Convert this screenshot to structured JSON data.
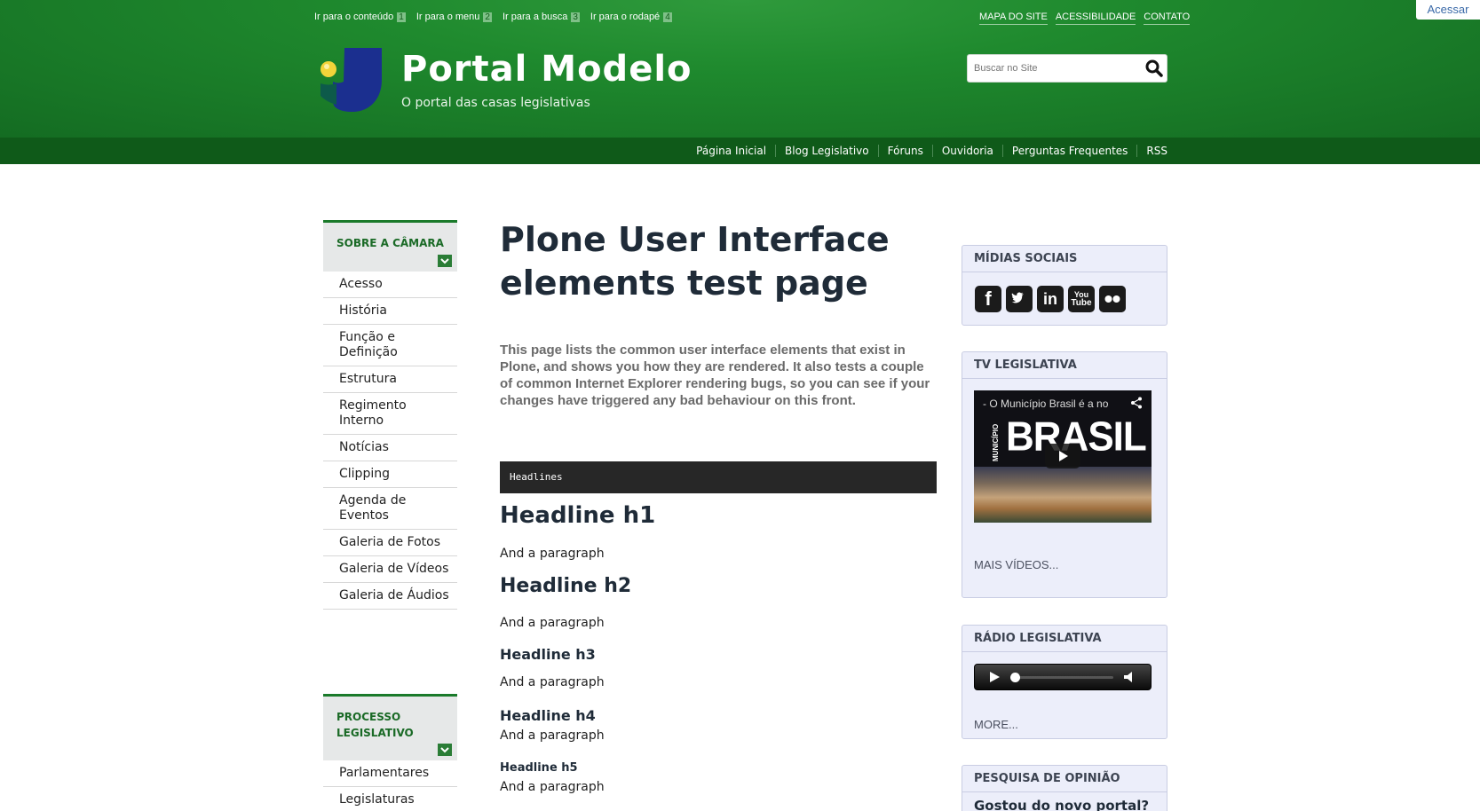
{
  "header": {
    "acessar_label": "Acessar",
    "skip_links": [
      {
        "label": "Ir para o conteúdo",
        "num": "1"
      },
      {
        "label": "Ir para o menu",
        "num": "2"
      },
      {
        "label": "Ir para a busca",
        "num": "3"
      },
      {
        "label": "Ir para o rodapé",
        "num": "4"
      }
    ],
    "top_links": [
      "MAPA DO SITE",
      "ACESSIBILIDADE",
      "CONTATO"
    ],
    "site_title": "Portal Modelo",
    "site_subtitle": "O portal das casas legislativas",
    "search_placeholder": "Buscar no Site"
  },
  "nav": [
    "Página Inicial",
    "Blog Legislativo",
    "Fóruns",
    "Ouvidoria",
    "Perguntas Frequentes",
    "RSS"
  ],
  "left": {
    "portlet1": {
      "title": "SOBRE A CÂMARA",
      "items": [
        "Acesso",
        "História",
        "Função e Definição",
        "Estrutura",
        "Regimento Interno",
        "Notícias",
        "Clipping",
        "Agenda de Eventos",
        "Galeria de Fotos",
        "Galeria de Vídeos",
        "Galeria de Áudios"
      ]
    },
    "portlet2": {
      "title_line1": "PROCESSO",
      "title_line2": "LEGISLATIVO",
      "items": [
        "Parlamentares",
        "Legislaturas"
      ]
    }
  },
  "content": {
    "title": "Plone User Interface elements test page",
    "description": "This page lists the common user interface elements that exist in Plone, and shows you how they are rendered. It also tests a couple of common Internet Explorer rendering bugs, so you can see if your changes have triggered any bad behaviour on this front.",
    "code_bar": "Headlines",
    "h1": "Headline h1",
    "h2": "Headline h2",
    "h3": "Headline h3",
    "h4": "Headline h4",
    "h5": "Headline h5",
    "paragraph": "And a paragraph"
  },
  "right": {
    "social_title": "MÍDIAS SOCIAIS",
    "social_icons": [
      "facebook-icon",
      "twitter-icon",
      "linkedin-icon",
      "youtube-icon",
      "flickr-icon"
    ],
    "tv_title": "TV LEGISLATIVA",
    "video_title": "- O Município Brasil é a no",
    "video_brand": "BRASIL",
    "video_side": "MUNICÍPIO",
    "tv_more": "MAIS VÍDEOS...",
    "radio_title": "RÁDIO LEGISLATIVA",
    "radio_more": "MORE...",
    "poll_title": "PESQUISA DE OPINIÃO",
    "poll_question": "Gostou do novo portal?"
  },
  "colors": {
    "header_green": "#1f8a2e",
    "nav_green": "#0f5a19",
    "portlet_accent": "#1a7a2a",
    "sidebar_bg": "#eceefa"
  }
}
